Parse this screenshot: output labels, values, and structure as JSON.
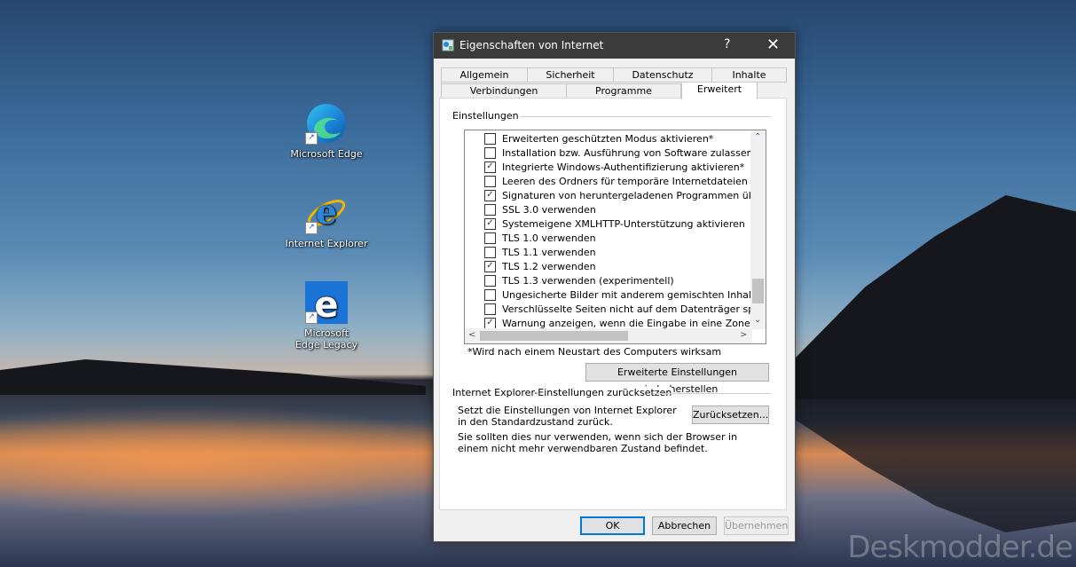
{
  "desktop": {
    "icons": [
      {
        "label": "Microsoft Edge",
        "icon": "edge-icon"
      },
      {
        "label": "Internet Explorer",
        "icon": "ie-icon"
      },
      {
        "label": "Microsoft Edge Legacy",
        "icon": "edge-legacy-icon"
      }
    ],
    "watermark": "Deskmodder.de"
  },
  "dialog": {
    "title": "Eigenschaften von Internet",
    "help": "?",
    "close": "✕",
    "tabs_row1": [
      "Allgemein",
      "Sicherheit",
      "Datenschutz",
      "Inhalte"
    ],
    "tabs_row2": [
      "Verbindungen",
      "Programme",
      "Erweitert"
    ],
    "active_tab": "Erweitert",
    "settings_label": "Einstellungen",
    "settings": [
      {
        "label": "Erweiterten geschützten Modus aktivieren*",
        "checked": false
      },
      {
        "label": "Installation bzw. Ausführung von Software zulassen, auch",
        "checked": false
      },
      {
        "label": "Integrierte Windows-Authentifizierung aktivieren*",
        "checked": true
      },
      {
        "label": "Leeren des Ordners für temporäre Internetdateien beim S",
        "checked": false
      },
      {
        "label": "Signaturen von heruntergeladenen Programmen überprüfe",
        "checked": true
      },
      {
        "label": "SSL 3.0 verwenden",
        "checked": false
      },
      {
        "label": "Systemeigene XMLHTTP-Unterstützung aktivieren",
        "checked": true
      },
      {
        "label": "TLS 1.0 verwenden",
        "checked": false
      },
      {
        "label": "TLS 1.1 verwenden",
        "checked": false
      },
      {
        "label": "TLS 1.2 verwenden",
        "checked": true
      },
      {
        "label": "TLS 1.3 verwenden (experimentell)",
        "checked": false
      },
      {
        "label": "Ungesicherte Bilder mit anderem gemischten Inhalt blockie",
        "checked": false
      },
      {
        "label": "Verschlüsselte Seiten nicht auf dem Datenträger speicherr",
        "checked": false
      },
      {
        "label": "Warnung anzeigen, wenn die Eingabe in eine Zone umgele",
        "checked": true
      }
    ],
    "restart_note": "*Wird nach einem Neustart des Computers wirksam",
    "restore_button": "Erweiterte Einstellungen wiederherstellen",
    "reset_group_label": "Internet Explorer-Einstellungen zurücksetzen",
    "reset_desc": "Setzt die Einstellungen von Internet Explorer in den Standardzustand zurück.",
    "reset_button": "Zurücksetzen...",
    "reset_note": "Sie sollten dies nur verwenden, wenn sich der Browser in einem nicht mehr verwendbaren Zustand befindet.",
    "ok": "OK",
    "cancel": "Abbrechen",
    "apply": "Übernehmen"
  }
}
